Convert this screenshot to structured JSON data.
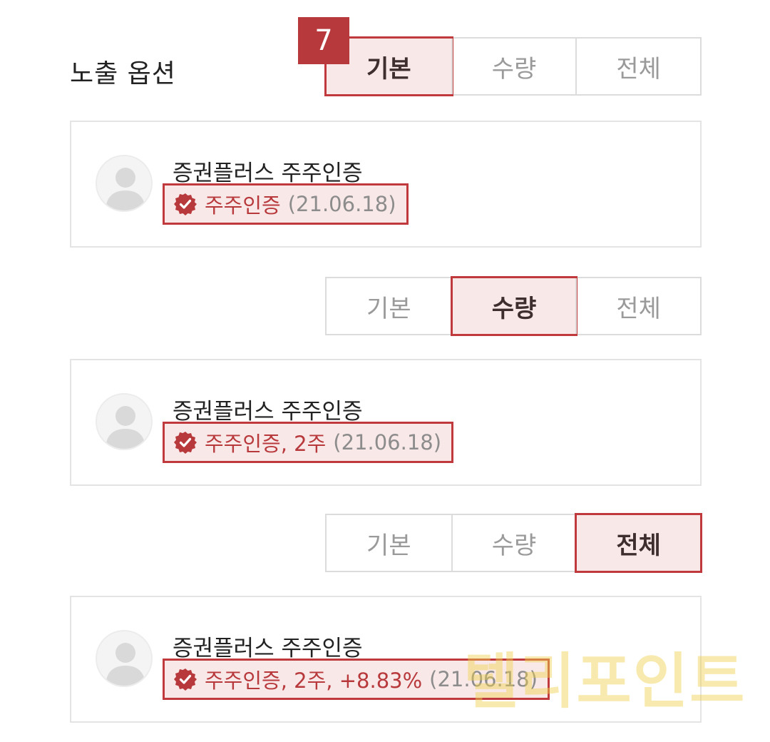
{
  "header": {
    "title": "노출 옵션",
    "step_number": "7"
  },
  "options": [
    "기본",
    "수량",
    "전체"
  ],
  "examples": [
    {
      "selected": "기본",
      "name": "증권플러스 주주인증",
      "cert_text": "주주인증",
      "date": "(21.06.18)"
    },
    {
      "selected": "수량",
      "name": "증권플러스 주주인증",
      "cert_text": "주주인증, 2주",
      "date": "(21.06.18)"
    },
    {
      "selected": "전체",
      "name": "증권플러스 주주인증",
      "cert_text": "주주인증, 2주, +8.83%",
      "date": "(21.06.18)"
    }
  ],
  "watermark": "텔리포인트",
  "colors": {
    "accent": "#c0393d",
    "highlight": "#f6e0e0",
    "border": "#dcdcdc",
    "muted": "#9a9a9a"
  },
  "icons": {
    "check": "check-badge-icon",
    "avatar": "user-silhouette-icon"
  }
}
